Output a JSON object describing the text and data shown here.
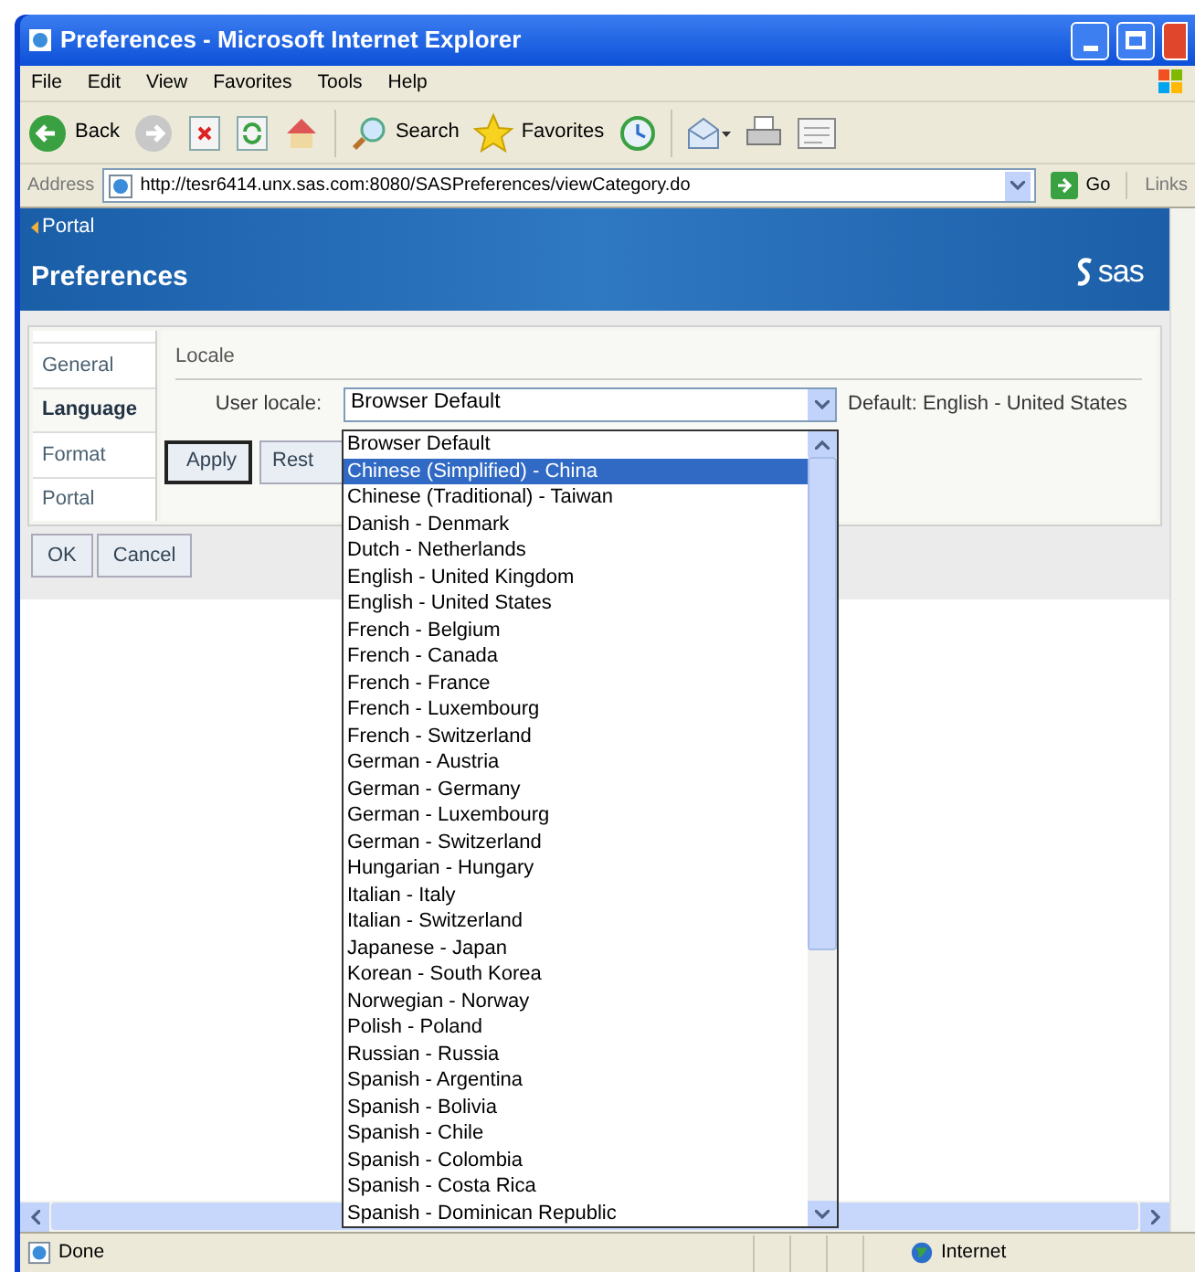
{
  "window": {
    "title": "Preferences - Microsoft Internet Explorer"
  },
  "menu": [
    "File",
    "Edit",
    "View",
    "Favorites",
    "Tools",
    "Help"
  ],
  "toolbar": [
    {
      "kind": "back",
      "label": "Back"
    },
    {
      "kind": "forward"
    },
    {
      "kind": "stop"
    },
    {
      "kind": "refresh"
    },
    {
      "kind": "home"
    },
    {
      "kind": "search",
      "label": "Search"
    },
    {
      "kind": "favorites",
      "label": "Favorites"
    },
    {
      "kind": "history"
    },
    {
      "kind": "mail"
    },
    {
      "kind": "print"
    },
    {
      "kind": "edit"
    }
  ],
  "address_bar": {
    "label": "Address",
    "url": "http://tesr6414.unx.sas.com:8080/SASPreferences/viewCategory.do",
    "go": "Go",
    "links": "Links"
  },
  "header": {
    "portal_link": "Portal",
    "title": "Preferences",
    "logo": "sas"
  },
  "tabs": [
    {
      "label": "General",
      "selected": false
    },
    {
      "label": "Language",
      "selected": true
    },
    {
      "label": "Format",
      "selected": false
    },
    {
      "label": "Portal",
      "selected": false
    }
  ],
  "section": {
    "title": "Locale",
    "field_label": "User locale:",
    "value": "Browser Default",
    "default_note": "Default: English - United States"
  },
  "panel_buttons": [
    "Apply",
    "Rest"
  ],
  "buttons": [
    "OK",
    "Cancel"
  ],
  "dropdown": [
    {
      "label": "Browser Default",
      "selected": false
    },
    {
      "label": "Chinese (Simplified) - China",
      "selected": true
    },
    {
      "label": "Chinese (Traditional) - Taiwan",
      "selected": false
    },
    {
      "label": "Danish - Denmark",
      "selected": false
    },
    {
      "label": "Dutch - Netherlands",
      "selected": false
    },
    {
      "label": "English - United Kingdom",
      "selected": false
    },
    {
      "label": "English - United States",
      "selected": false
    },
    {
      "label": "French - Belgium",
      "selected": false
    },
    {
      "label": "French - Canada",
      "selected": false
    },
    {
      "label": "French - France",
      "selected": false
    },
    {
      "label": "French - Luxembourg",
      "selected": false
    },
    {
      "label": "French - Switzerland",
      "selected": false
    },
    {
      "label": "German - Austria",
      "selected": false
    },
    {
      "label": "German - Germany",
      "selected": false
    },
    {
      "label": "German - Luxembourg",
      "selected": false
    },
    {
      "label": "German - Switzerland",
      "selected": false
    },
    {
      "label": "Hungarian - Hungary",
      "selected": false
    },
    {
      "label": "Italian - Italy",
      "selected": false
    },
    {
      "label": "Italian - Switzerland",
      "selected": false
    },
    {
      "label": "Japanese - Japan",
      "selected": false
    },
    {
      "label": "Korean - South Korea",
      "selected": false
    },
    {
      "label": "Norwegian - Norway",
      "selected": false
    },
    {
      "label": "Polish - Poland",
      "selected": false
    },
    {
      "label": "Russian - Russia",
      "selected": false
    },
    {
      "label": "Spanish - Argentina",
      "selected": false
    },
    {
      "label": "Spanish - Bolivia",
      "selected": false
    },
    {
      "label": "Spanish - Chile",
      "selected": false
    },
    {
      "label": "Spanish - Colombia",
      "selected": false
    },
    {
      "label": "Spanish - Costa Rica",
      "selected": false
    },
    {
      "label": "Spanish - Dominican Republic",
      "selected": false
    }
  ],
  "status_bar": {
    "text": "Done",
    "zone": "Internet"
  }
}
